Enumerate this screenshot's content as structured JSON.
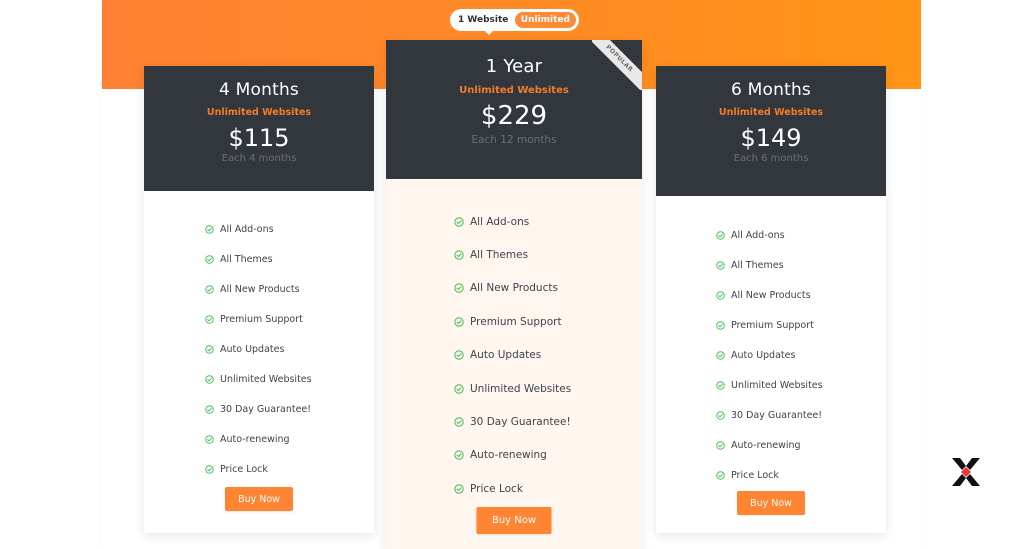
{
  "toggle": {
    "options": [
      "1 Website",
      "Unlimited"
    ],
    "selected": "Unlimited"
  },
  "colors": {
    "accent": "#ff8532",
    "card_header": "#32373d",
    "check": "#4cc05a",
    "featured_bg": "#fff6ef"
  },
  "plans": [
    {
      "name": "4 Months",
      "sites": "Unlimited Websites",
      "price": "$115",
      "period": "Each 4 months",
      "features": [
        "All Add-ons",
        "All Themes",
        "All New Products",
        "Premium Support",
        "Auto Updates",
        "Unlimited Websites",
        "30 Day Guarantee!",
        "Auto-renewing",
        "Price Lock"
      ],
      "cta": "Buy Now"
    },
    {
      "name": "1 Year",
      "sites": "Unlimited Websites",
      "price": "$229",
      "period": "Each 12 months",
      "badge": "POPULAR",
      "features": [
        "All Add-ons",
        "All Themes",
        "All New Products",
        "Premium Support",
        "Auto Updates",
        "Unlimited Websites",
        "30 Day Guarantee!",
        "Auto-renewing",
        "Price Lock"
      ],
      "cta": "Buy Now"
    },
    {
      "name": "6 Months",
      "sites": "Unlimited Websites",
      "price": "$149",
      "period": "Each 6 months",
      "features": [
        "All Add-ons",
        "All Themes",
        "All New Products",
        "Premium Support",
        "Auto Updates",
        "Unlimited Websites",
        "30 Day Guarantee!",
        "Auto-renewing",
        "Price Lock"
      ],
      "cta": "Buy Now"
    }
  ],
  "logo": {
    "icon": "k-brand-logo"
  }
}
